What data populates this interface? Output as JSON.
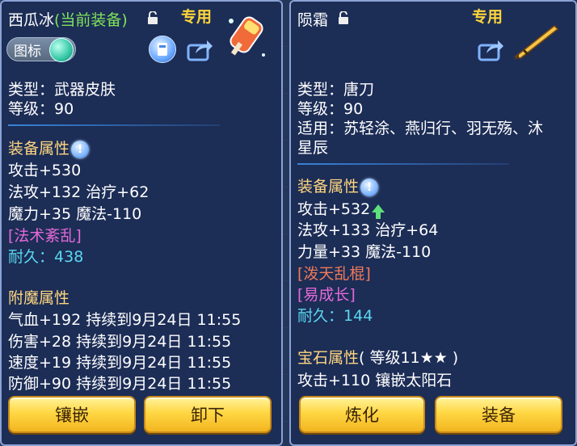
{
  "left_panel": {
    "title": "西瓜冰",
    "equipped_tag": "(当前装备)",
    "special_label": "专用",
    "icon_pill_label": "图标",
    "type_line": "类型：武器皮肤",
    "level_line": "等级：90",
    "equip_attr_title": "装备属性",
    "attrs": [
      "攻击+530",
      "法攻+132 治疗+62",
      "魔力+35 魔法-110"
    ],
    "special_effect": "[法术紊乱]",
    "durability_label": "耐久：",
    "durability_value": "438",
    "enchant_title": "附魔属性",
    "enchant_lines": [
      "气血+192 持续到9月24日 11:55",
      "伤害+28 持续到9月24日 11:55",
      "速度+19 持续到9月24日 11:55",
      "防御+90 持续到9月24日 11:55"
    ],
    "buttons": {
      "inlay": "镶嵌",
      "unequip": "卸下"
    }
  },
  "right_panel": {
    "title": "陨霜",
    "special_label": "专用",
    "type_line": "类型：唐刀",
    "level_line": "等级：90",
    "suitable_line1": "适用：苏轻涂、燕归行、羽无殇、沐",
    "suitable_line2": "星辰",
    "equip_attr_title": "装备属性",
    "attack_line": "攻击+532",
    "attrs": [
      "法攻+133 治疗+64",
      "力量+33 魔法-110"
    ],
    "special_effect1": "[泼天乱棍]",
    "special_effect2": "[易成长]",
    "durability_label": "耐久：",
    "durability_value": "144",
    "gem_title": "宝石属性",
    "gem_detail": "( 等级11★★ )",
    "gem_line": "攻击+110 镶嵌太阳石",
    "buttons": {
      "refine": "炼化",
      "equip": "装备"
    }
  },
  "colors": {
    "panel_bg": "#1c2c56",
    "section_title": "#ffd680",
    "special_label": "#ffd63a",
    "cyan_text": "#5ad8ee",
    "magenta_text": "#e46ad8",
    "red_text": "#f07a5a",
    "green_tag": "#7fe45a"
  },
  "icons": [
    "lock-icon",
    "gem-icon",
    "bag-icon",
    "share-icon",
    "popsicle-skin-icon",
    "tang-blade-icon",
    "info-icon",
    "up-arrow-icon"
  ]
}
